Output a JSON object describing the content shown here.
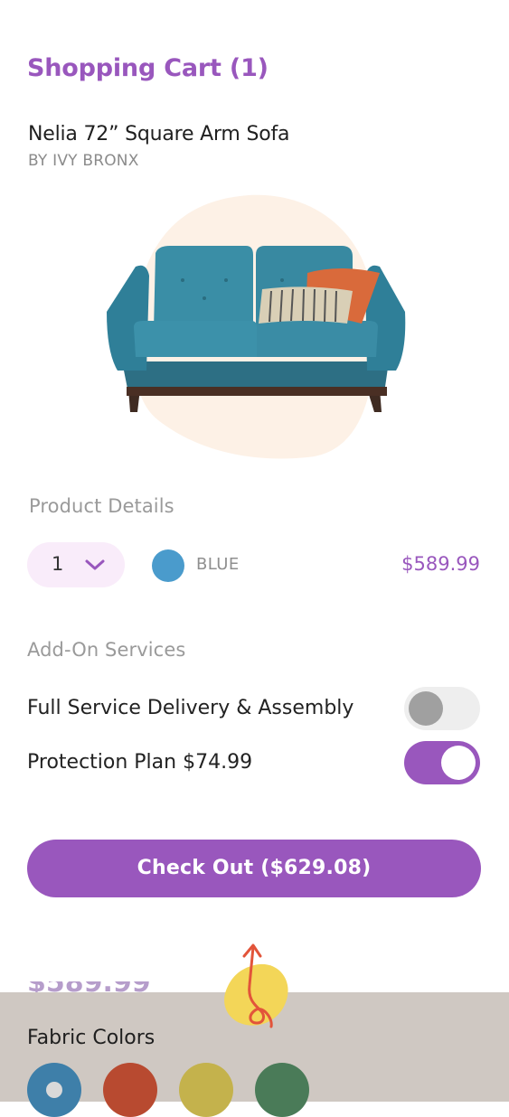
{
  "header": {
    "title": "Shopping Cart (1)"
  },
  "product": {
    "name": "Nelia 72” Square Arm Sofa",
    "brand": "BY IVY BRONX",
    "image_icon": "sofa-image"
  },
  "details": {
    "label": "Product Details",
    "quantity": "1",
    "color_name": "BLUE",
    "color_hex": "#4a9bcc",
    "price": "$589.99"
  },
  "addons": {
    "label": "Add-On Services",
    "items": [
      {
        "label": "Full Service Delivery & Assembly",
        "enabled": false
      },
      {
        "label": "Protection Plan $74.99",
        "enabled": true
      }
    ]
  },
  "checkout": {
    "label": "Check Out ($629.08)"
  },
  "colors": {
    "accent": "#9957bd",
    "panel_bg": "#cfc8c2"
  },
  "fabric": {
    "title": "Fabric Colors",
    "swatches": [
      {
        "name": "blue",
        "hex": "#3e7fa9",
        "selected": true
      },
      {
        "name": "red",
        "hex": "#b84a30",
        "selected": false
      },
      {
        "name": "yellow",
        "hex": "#c4b24c",
        "selected": false
      },
      {
        "name": "green",
        "hex": "#4a7b58",
        "selected": false
      }
    ]
  },
  "peek": {
    "price": "$589.99"
  }
}
